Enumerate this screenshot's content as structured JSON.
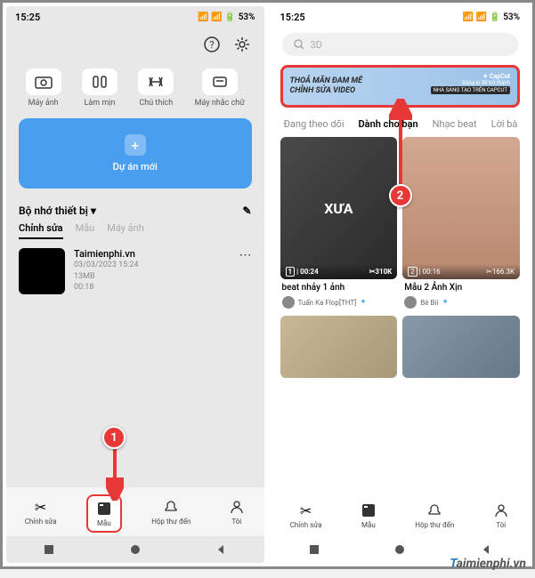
{
  "status": {
    "time": "15:25",
    "battery": "53%",
    "signal": "▲▲"
  },
  "left": {
    "actions": [
      {
        "icon": "camera",
        "label": "Máy ảnh"
      },
      {
        "icon": "smooth",
        "label": "Làm mịn"
      },
      {
        "icon": "caption",
        "label": "Chú thích"
      },
      {
        "icon": "teleprompter",
        "label": "Máy nhắc chữ"
      }
    ],
    "new_project": "Dự án mới",
    "section": "Bộ nhớ thiết bị",
    "tabs": [
      "Chỉnh sửa",
      "Mẫu",
      "Máy ảnh"
    ],
    "project": {
      "title": "Taimienphi.vn",
      "date": "03/03/2023 15:24",
      "size": "13MB",
      "duration": "00:18"
    },
    "nav": [
      "Chỉnh sửa",
      "Mẫu",
      "Hộp thư đến",
      "Tôi"
    ]
  },
  "right": {
    "search_placeholder": "3D",
    "banner": {
      "line1": "THOẢ MÃN ĐAM MÊ",
      "line2": "CHỈNH SỬA VIDEO",
      "brand": "CapCut",
      "sub1": "Đăng kí để trở thành",
      "sub2": "NHÀ SÁNG TẠO TRÊN CAPCUT"
    },
    "feed_tabs": [
      "Đang theo dõi",
      "Dành cho bạn",
      "Nhạc beat",
      "Lời bà"
    ],
    "videos": [
      {
        "text": "XƯA",
        "count": "1",
        "dur": "| 00:24",
        "uses": "✂310K",
        "title": "beat nhảy 1 ảnh",
        "author": "Tuấn Ka Flop[THT]"
      },
      {
        "text": "",
        "count": "2",
        "dur": "| 00:16",
        "uses": "✂166.3K",
        "title": "Mẫu 2 Ảnh Xịn",
        "author": "Bé Bii"
      }
    ],
    "nav": [
      "Chỉnh sửa",
      "Mẫu",
      "Hộp thư đến",
      "Tôi"
    ]
  },
  "callouts": {
    "c1": "1",
    "c2": "2"
  },
  "watermark": {
    "t": "T",
    "rest": "aimienphi.vn"
  }
}
